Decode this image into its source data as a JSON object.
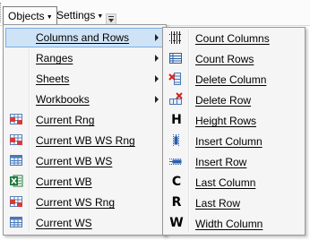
{
  "menubar": {
    "menus": [
      {
        "label": "Objects",
        "active": true
      },
      {
        "label": "Settings",
        "active": false
      }
    ]
  },
  "objects_menu": {
    "items": [
      {
        "label": "Columns and Rows",
        "submenu": true,
        "highlighted": true,
        "icon": null
      },
      {
        "label": "Ranges",
        "submenu": true,
        "icon": null
      },
      {
        "label": "Sheets",
        "submenu": true,
        "icon": null
      },
      {
        "label": "Workbooks",
        "submenu": true,
        "icon": null
      },
      {
        "label": "Current Rng",
        "submenu": false,
        "icon": "range-grid-red-icon"
      },
      {
        "label": "Current WB WS Rng",
        "submenu": false,
        "icon": "range-grid-red-icon"
      },
      {
        "label": "Current WB WS",
        "submenu": false,
        "icon": "sheet-grid-blue-icon"
      },
      {
        "label": "Current WB",
        "submenu": false,
        "icon": "excel-workbook-icon"
      },
      {
        "label": "Current WS Rng",
        "submenu": false,
        "icon": "range-grid-red-icon"
      },
      {
        "label": "Current WS",
        "submenu": false,
        "icon": "sheet-grid-blue-icon"
      }
    ]
  },
  "columns_rows_submenu": {
    "items": [
      {
        "label": "Count Columns",
        "icon": "count-columns-icon"
      },
      {
        "label": "Count Rows",
        "icon": "count-rows-icon"
      },
      {
        "label": "Delete Column",
        "icon": "delete-column-icon"
      },
      {
        "label": "Delete Row",
        "icon": "delete-row-icon"
      },
      {
        "label": "Height Rows",
        "icon": "letter-h-icon",
        "glyph": "H"
      },
      {
        "label": "Insert Column",
        "icon": "insert-column-icon"
      },
      {
        "label": "Insert Row",
        "icon": "insert-row-icon"
      },
      {
        "label": "Last Column",
        "icon": "letter-c-icon",
        "glyph": "C"
      },
      {
        "label": "Last Row",
        "icon": "letter-r-icon",
        "glyph": "R"
      },
      {
        "label": "Width Column",
        "icon": "letter-w-icon",
        "glyph": "W"
      }
    ]
  },
  "colors": {
    "highlight_bg": "#cfe3f7",
    "highlight_border": "#7aaee3",
    "menu_bg": "#f5f5f5"
  }
}
